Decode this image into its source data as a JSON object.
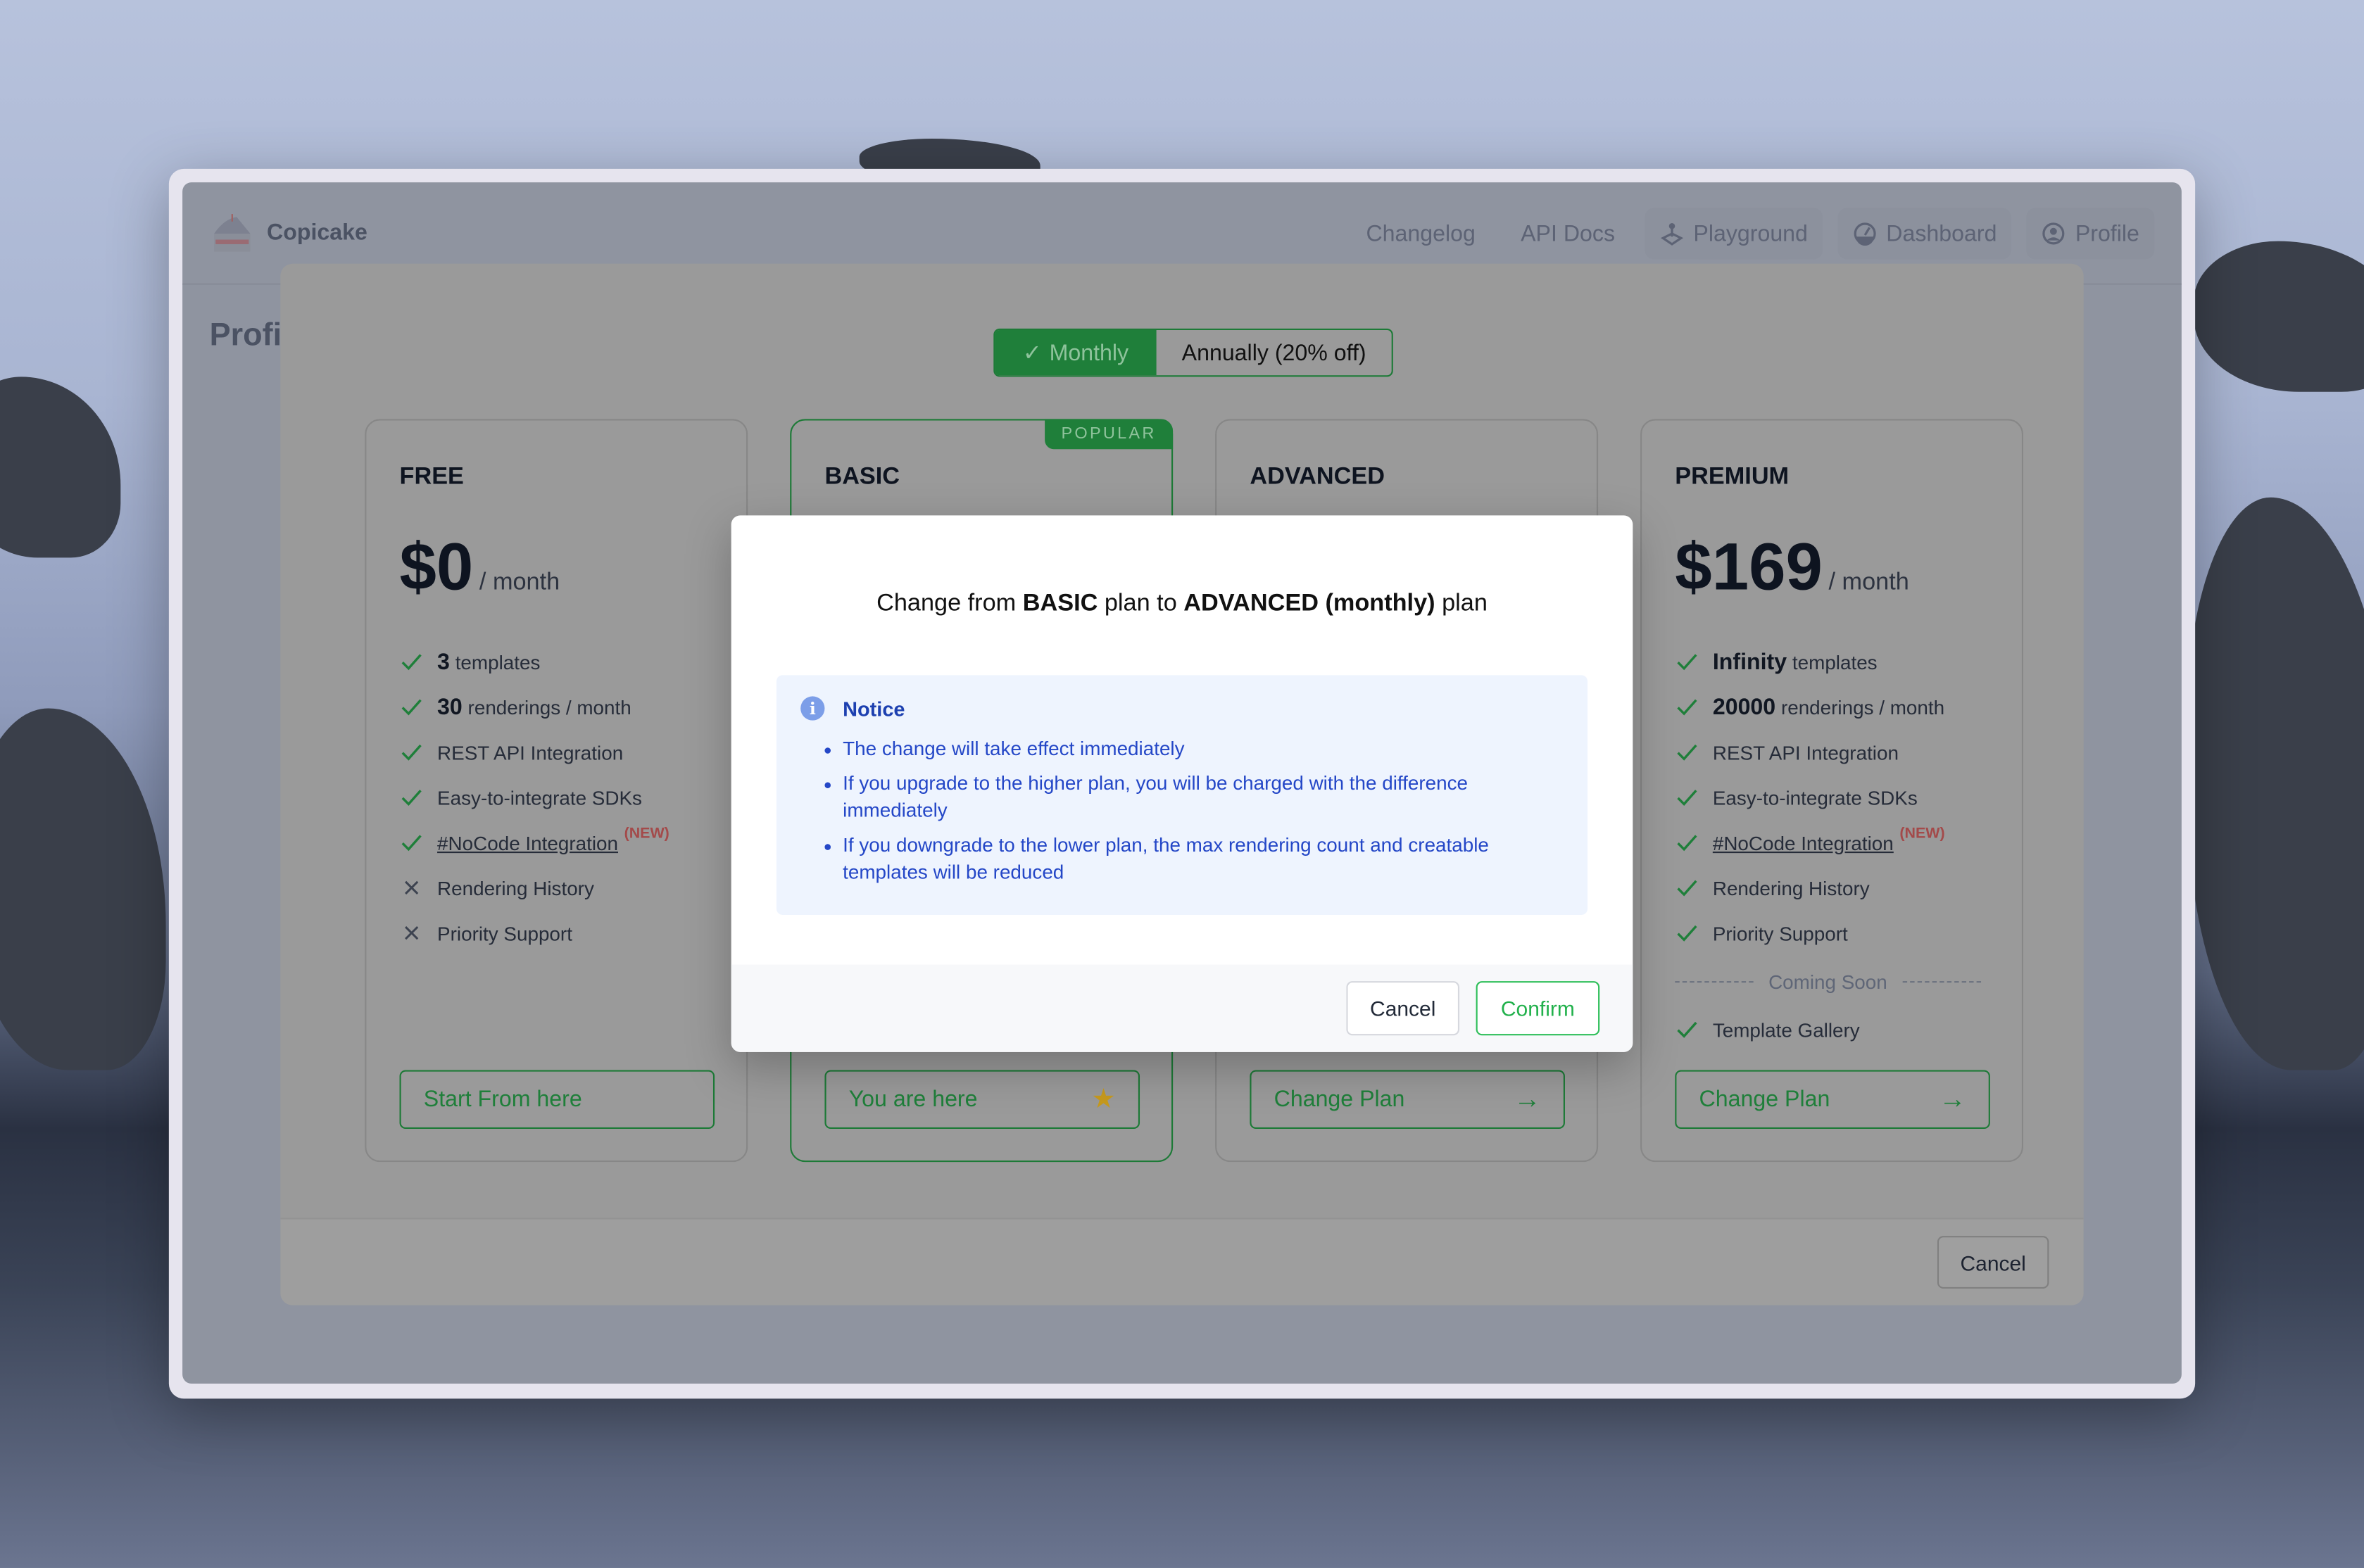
{
  "app": {
    "brand": "Copicake",
    "page_title_partial": "Profi"
  },
  "nav": [
    {
      "label": "Changelog",
      "icon": "none"
    },
    {
      "label": "API Docs",
      "icon": "none"
    },
    {
      "label": "Playground",
      "icon": "joystick-icon"
    },
    {
      "label": "Dashboard",
      "icon": "gauge-icon"
    },
    {
      "label": "Profile",
      "icon": "user-circle-icon"
    }
  ],
  "billing_toggle": {
    "monthly": "Monthly",
    "annually": "Annually (20% off)",
    "selected": "Monthly"
  },
  "plans": {
    "free": {
      "title": "FREE",
      "price": "$0",
      "per": "/ month",
      "features": [
        {
          "bold": "3",
          "text": "templates",
          "included": true
        },
        {
          "bold": "30",
          "text": "renderings / month",
          "included": true
        },
        {
          "text": "REST API Integration",
          "included": true
        },
        {
          "text": "Easy-to-integrate SDKs",
          "included": true
        },
        {
          "text": "#NoCode Integration",
          "tag": "(NEW)",
          "link": true,
          "included": true
        },
        {
          "text": "Rendering History",
          "included": false
        },
        {
          "text": "Priority Support",
          "included": false
        }
      ],
      "button": "Start From here"
    },
    "basic": {
      "title": "BASIC",
      "badge": "POPULAR",
      "button": "You are here"
    },
    "advanced": {
      "title": "ADVANCED",
      "button": "Change Plan"
    },
    "premium": {
      "title": "PREMIUM",
      "price": "$169",
      "per": "/ month",
      "features": [
        {
          "bold": "Infinity",
          "text": "templates",
          "included": true
        },
        {
          "bold": "20000",
          "text": "renderings / month",
          "included": true
        },
        {
          "text": "REST API Integration",
          "included": true
        },
        {
          "text": "Easy-to-integrate SDKs",
          "included": true
        },
        {
          "text": "#NoCode Integration",
          "tag": "(NEW)",
          "link": true,
          "included": true
        },
        {
          "text": "Rendering History",
          "included": true
        },
        {
          "text": "Priority Support",
          "included": true
        }
      ],
      "coming_soon_label": "Coming Soon",
      "coming_soon": [
        {
          "text": "Template Gallery",
          "included": true
        }
      ],
      "button": "Change Plan"
    }
  },
  "panel": {
    "cancel": "Cancel"
  },
  "dialog": {
    "title_prefix": "Change from",
    "from_plan": "BASIC",
    "title_mid": "plan to",
    "to_plan": "ADVANCED (monthly)",
    "title_suffix": "plan",
    "notice": {
      "heading": "Notice",
      "items": [
        "The change will take effect immediately",
        "If you upgrade to the higher plan, you will be charged with the difference immediately",
        "If you downgrade to the lower plan, the max rendering count and creatable templates will be reduced"
      ]
    },
    "cancel": "Cancel",
    "confirm": "Confirm"
  },
  "colors": {
    "accent": "#22b14c",
    "notice_bg": "#eef4fe",
    "notice_text": "#2447c7",
    "new_tag": "#a34a4a"
  }
}
